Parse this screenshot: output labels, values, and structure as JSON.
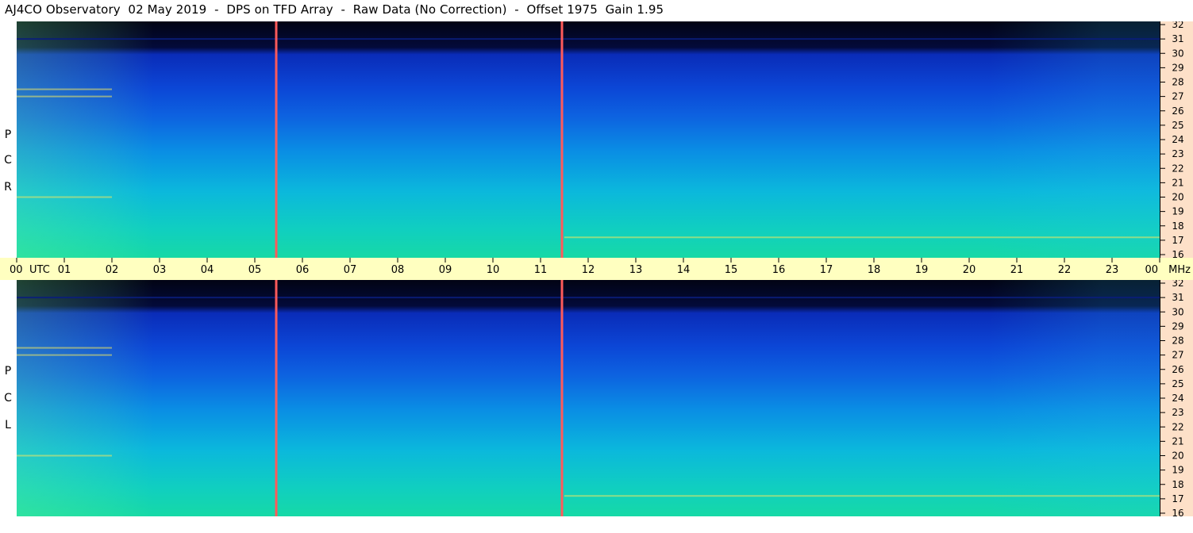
{
  "title": "AJ4CO Observatory  02 May 2019  -  DPS on TFD Array  -  Raw Data (No Correction)  -  Offset 1975  Gain 1.95",
  "panels": [
    {
      "id": "rcp",
      "label_letters": [
        "P",
        "C",
        "R"
      ]
    },
    {
      "id": "lcp",
      "label_letters": [
        "P",
        "C",
        "L"
      ]
    }
  ],
  "colors": {
    "background": "#ffffff",
    "time_band": "#ffffc0",
    "freq_axis_bg": "#fde0c8",
    "marker_line": "#ff5a5a",
    "spectrogram_low": "#020414",
    "spectrogram_mid": "#0c46d6",
    "spectrogram_high": "#16d9a6"
  },
  "chart_data": {
    "type": "heatmap",
    "title": "AJ4CO Observatory  02 May 2019  -  DPS on TFD Array  -  Raw Data (No Correction)  -  Offset 1975  Gain 1.95",
    "x_axis": {
      "label": "UTC",
      "unit_label": "MHz",
      "tick_labels": [
        "00",
        "01",
        "02",
        "03",
        "04",
        "05",
        "06",
        "07",
        "08",
        "09",
        "10",
        "11",
        "12",
        "13",
        "14",
        "15",
        "16",
        "17",
        "18",
        "19",
        "20",
        "21",
        "22",
        "23",
        "00"
      ],
      "range_hours": [
        0,
        24
      ]
    },
    "y_axis": {
      "unit": "MHz",
      "tick_labels": [
        32,
        31,
        30,
        29,
        28,
        27,
        26,
        25,
        24,
        23,
        22,
        21,
        20,
        19,
        18,
        17,
        16
      ],
      "range": [
        16,
        32
      ]
    },
    "panels": [
      "R C P",
      "L C P"
    ],
    "marker_lines_utc_hours": [
      5.45,
      11.45
    ],
    "bright_band_frequencies_mhz": [
      17.2,
      20.0,
      27.0,
      27.5,
      31.0
    ]
  }
}
